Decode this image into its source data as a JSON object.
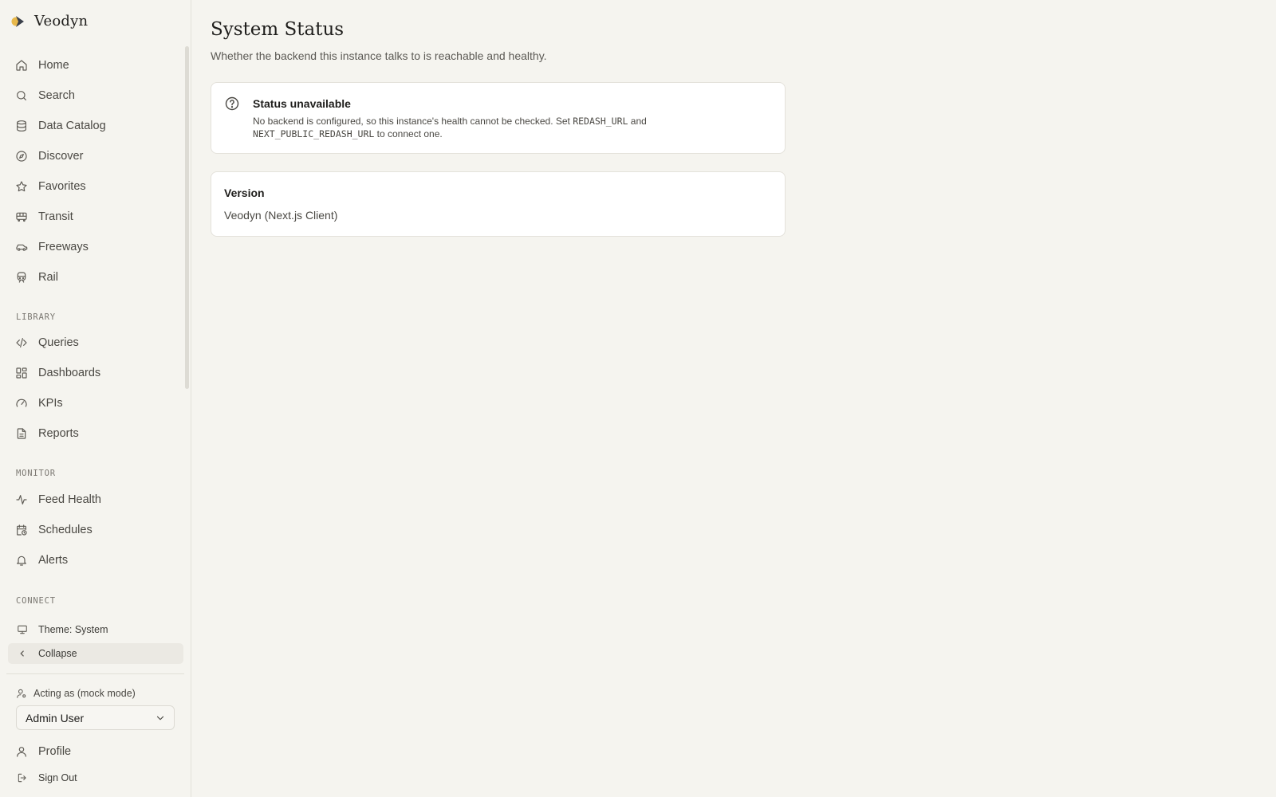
{
  "brand": {
    "name": "Veodyn",
    "logo_icon": "veodyn-logo"
  },
  "nav": {
    "primary": [
      {
        "label": "Home",
        "icon": "home-icon"
      },
      {
        "label": "Search",
        "icon": "search-icon"
      },
      {
        "label": "Data Catalog",
        "icon": "database-icon"
      },
      {
        "label": "Discover",
        "icon": "compass-icon"
      },
      {
        "label": "Favorites",
        "icon": "star-icon"
      },
      {
        "label": "Transit",
        "icon": "bus-icon"
      },
      {
        "label": "Freeways",
        "icon": "car-icon"
      },
      {
        "label": "Rail",
        "icon": "train-icon"
      }
    ],
    "library_label": "LIBRARY",
    "library": [
      {
        "label": "Queries",
        "icon": "code-icon"
      },
      {
        "label": "Dashboards",
        "icon": "dashboard-icon"
      },
      {
        "label": "KPIs",
        "icon": "gauge-icon"
      },
      {
        "label": "Reports",
        "icon": "file-text-icon"
      }
    ],
    "monitor_label": "MONITOR",
    "monitor": [
      {
        "label": "Feed Health",
        "icon": "activity-icon"
      },
      {
        "label": "Schedules",
        "icon": "calendar-clock-icon"
      },
      {
        "label": "Alerts",
        "icon": "bell-icon"
      }
    ],
    "connect_label": "CONNECT",
    "theme_label": "Theme: System",
    "collapse_label": "Collapse",
    "acting_as_label": "Acting as (mock mode)",
    "acting_user": "Admin User",
    "profile_label": "Profile",
    "sign_out_label": "Sign Out"
  },
  "page": {
    "title": "System Status",
    "subtitle": "Whether the backend this instance talks to is reachable and healthy."
  },
  "status_card": {
    "icon": "help-circle-icon",
    "title": "Status unavailable",
    "desc_part1": "No backend is configured, so this instance's health cannot be checked. Set ",
    "env_var_1": "REDASH_URL",
    "desc_part2": " and",
    "env_var_2": "NEXT_PUBLIC_REDASH_URL",
    "desc_part3": " to connect one."
  },
  "version_card": {
    "title": "Version",
    "value": "Veodyn (Next.js Client)"
  },
  "colors": {
    "background": "#f5f4ef",
    "card": "#ffffff",
    "border": "#e4e2db",
    "logo_accent": "#e8b84a",
    "logo_dark": "#3a3f4a"
  }
}
